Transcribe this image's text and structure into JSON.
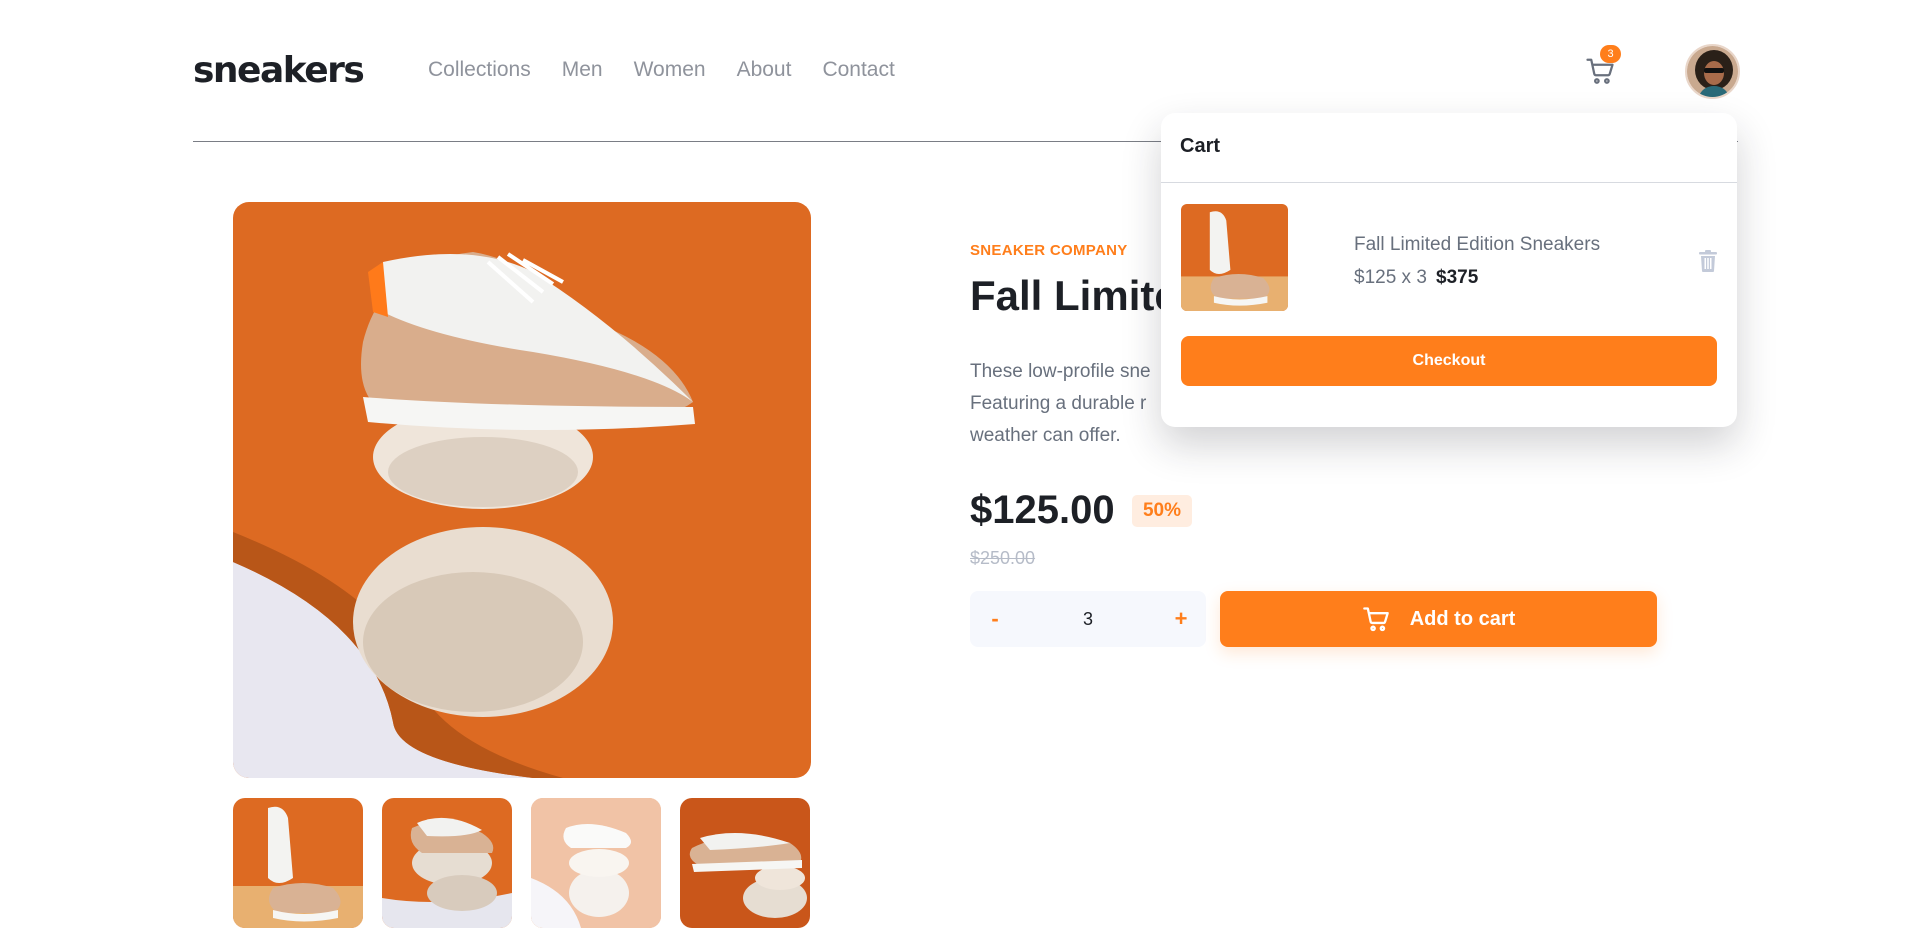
{
  "header": {
    "logo": "sneakers",
    "nav": [
      "Collections",
      "Men",
      "Women",
      "About",
      "Contact"
    ],
    "cart_count": "3"
  },
  "product": {
    "company": "SNEAKER COMPANY",
    "title": "Fall Limite",
    "description": "These low-profile sne Featuring a durable r weather can offer.",
    "price": "$125.00",
    "discount": "50%",
    "old_price": "$250.00",
    "quantity": "3",
    "minus_label": "-",
    "plus_label": "+",
    "add_to_cart_label": "Add to cart"
  },
  "cart": {
    "title": "Cart",
    "item_name": "Fall Limited Edition Sneakers",
    "item_calc": "$125 x 3",
    "item_total": "$375",
    "checkout_label": "Checkout"
  },
  "colors": {
    "accent": "#ff7e1b",
    "accent_pale": "#ffede0",
    "text_dark": "#1d2026",
    "text_muted": "#68707d"
  }
}
